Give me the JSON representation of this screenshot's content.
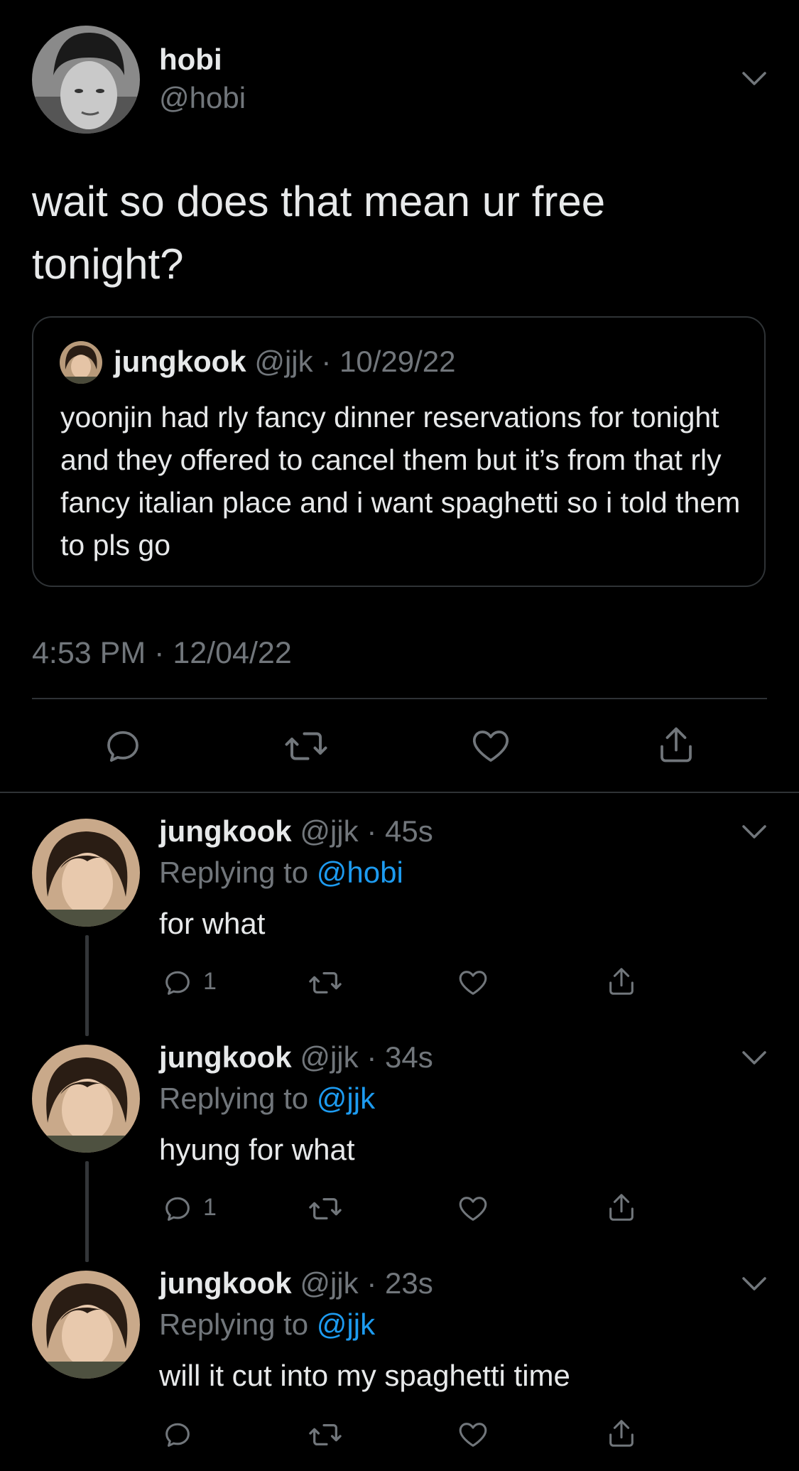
{
  "main_tweet": {
    "display_name": "hobi",
    "handle": "@hobi",
    "text": "wait so does that mean ur free tonight?",
    "timestamp": "4:53 PM · 12/04/22",
    "quote": {
      "display_name": "jungkook",
      "handle": "@jjk",
      "date": "· 10/29/22",
      "text": "yoonjin had rly fancy dinner reservations for tonight and they offered to cancel them but it’s from that rly fancy italian place and i want spaghetti so i told them to pls go"
    },
    "actions": [
      "reply-icon",
      "retweet-icon",
      "like-icon",
      "share-icon"
    ]
  },
  "replies": [
    {
      "display_name": "jungkook",
      "handle": "@jjk",
      "time": "· 45s",
      "replying_prefix": "Replying to",
      "replying_to": "@hobi",
      "text": "for what",
      "reply_count": "1"
    },
    {
      "display_name": "jungkook",
      "handle": "@jjk",
      "time": "· 34s",
      "replying_prefix": "Replying to",
      "replying_to": "@jjk",
      "text": "hyung for what",
      "reply_count": "1"
    },
    {
      "display_name": "jungkook",
      "handle": "@jjk",
      "time": "· 23s",
      "replying_prefix": "Replying to",
      "replying_to": "@jjk",
      "text": "will it cut into my spaghetti time",
      "reply_count": ""
    }
  ],
  "colors": {
    "background": "#000000",
    "text": "#e7e9ea",
    "muted": "#71767b",
    "link": "#1d9bf0",
    "border": "#2f3336"
  }
}
